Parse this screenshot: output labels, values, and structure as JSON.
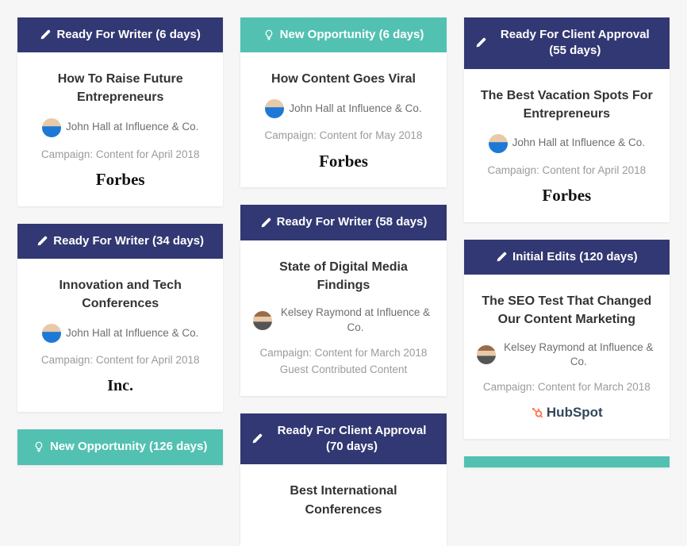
{
  "columns": [
    {
      "cards": [
        {
          "status_style": "navy",
          "status_icon": "pencil-icon",
          "status_label": "Ready For Writer (6 days)",
          "title": "How To Raise Future Entrepreneurs",
          "author_avatar": "john",
          "author_text": "John Hall at Influence & Co.",
          "campaign": "Campaign: Content for April 2018",
          "brand": "forbes",
          "brand_label": "Forbes"
        },
        {
          "status_style": "navy",
          "status_icon": "pencil-icon",
          "status_label": "Ready For Writer (34 days)",
          "title": "Innovation and Tech Conferences",
          "author_avatar": "john",
          "author_text": "John Hall at Influence & Co.",
          "campaign": "Campaign: Content for April 2018",
          "brand": "inc",
          "brand_label": "Inc."
        },
        {
          "status_style": "teal",
          "status_icon": "lightbulb-icon",
          "status_label": "New Opportunity (126 days)",
          "partial": true
        }
      ]
    },
    {
      "cards": [
        {
          "status_style": "teal",
          "status_icon": "lightbulb-icon",
          "status_label": "New Opportunity (6 days)",
          "title": "How Content Goes Viral",
          "author_avatar": "john",
          "author_text": "John Hall at Influence & Co.",
          "campaign": "Campaign: Content for May 2018",
          "brand": "forbes",
          "brand_label": "Forbes"
        },
        {
          "status_style": "navy",
          "status_icon": "pencil-icon",
          "status_label": "Ready For Writer (58 days)",
          "title": "State of Digital Media Findings",
          "author_avatar": "kelsey",
          "author_text": "Kelsey Raymond at Influence & Co.",
          "campaign": "Campaign: Content for March 2018",
          "subline": "Guest Contributed Content"
        },
        {
          "status_style": "navy",
          "status_icon": "pencil-icon",
          "status_label": "Ready For Client Approval (70 days)",
          "title": "Best International Conferences",
          "partial_body": true
        }
      ]
    },
    {
      "cards": [
        {
          "status_style": "navy",
          "status_icon": "pencil-icon",
          "status_label": "Ready For Client Approval (55 days)",
          "title": "The Best Vacation Spots For Entrepreneurs",
          "author_avatar": "john",
          "author_text": "John Hall at Influence & Co.",
          "campaign": "Campaign: Content for April 2018",
          "brand": "forbes",
          "brand_label": "Forbes"
        },
        {
          "status_style": "navy",
          "status_icon": "pencil-icon",
          "status_label": "Initial Edits (120 days)",
          "title": "The SEO Test That Changed Our Content Marketing",
          "author_avatar": "kelsey",
          "author_text": "Kelsey Raymond at Influence & Co.",
          "campaign": "Campaign: Content for March 2018",
          "brand": "hubspot",
          "brand_label": "HubSpot"
        },
        {
          "teal_strip": true
        }
      ]
    }
  ]
}
